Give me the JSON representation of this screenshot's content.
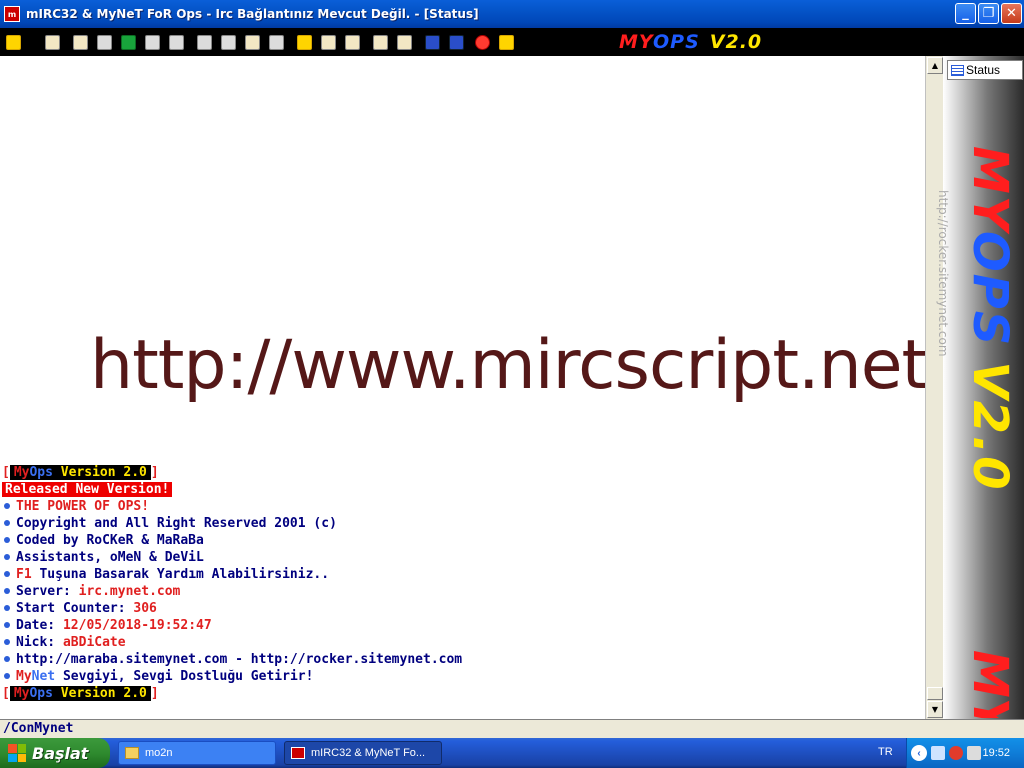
{
  "window": {
    "title": "mIRC32 & MyNeT FoR Ops - Irc Bağlantınız Mevcut Değil. - [Status]",
    "controls": {
      "minimize": "_",
      "restore": "❐",
      "close": "✕"
    }
  },
  "toolbar": {
    "icons": [
      "connect-icon",
      "options-icon",
      "channels-list-icon",
      "address-book-icon",
      "script-editor-icon",
      "dcc-icon",
      "notify-icon",
      "url-catcher-icon",
      "timer-icon",
      "colors-icon",
      "log-icon",
      "away-icon",
      "sounds-icon",
      "dcc-send-icon",
      "dcc-chat-icon",
      "notes-icon",
      "calendar-icon",
      "tile-icon",
      "cascade-icon",
      "help-icon",
      "lamp-icon"
    ],
    "brand": {
      "my": "MY",
      "ops": "OPS",
      "version": "V2.0"
    }
  },
  "status_window": {
    "watermark_url": "http://www.mircscript.net",
    "log": [
      {
        "type": "version",
        "open": "[",
        "my": "My",
        "ops": "Ops",
        "text": " Version 2.0",
        "close": "]"
      },
      {
        "type": "released",
        "text": "Released New Version!"
      },
      {
        "type": "line",
        "segments": [
          {
            "text": "THE POWER OF OPS!",
            "color": "red"
          }
        ]
      },
      {
        "type": "line",
        "segments": [
          {
            "text": "Copyright and All Right Reserved 2001 (c)",
            "color": "blue"
          }
        ]
      },
      {
        "type": "line",
        "segments": [
          {
            "text": "Coded by RoCKeR & MaRaBa",
            "color": "blue"
          }
        ]
      },
      {
        "type": "line",
        "segments": [
          {
            "text": "Assistants, oMeN & DeViL",
            "color": "blue"
          }
        ]
      },
      {
        "type": "line",
        "segments": [
          {
            "text": "F1",
            "color": "red"
          },
          {
            "text": " Tuşuna Basarak Yardım Alabilirsiniz..",
            "color": "blue"
          }
        ]
      },
      {
        "type": "line",
        "segments": [
          {
            "text": "Server: ",
            "color": "blue"
          },
          {
            "text": "irc.mynet.com",
            "color": "red"
          }
        ]
      },
      {
        "type": "line",
        "segments": [
          {
            "text": "Start Counter: ",
            "color": "blue"
          },
          {
            "text": "306",
            "color": "red"
          }
        ]
      },
      {
        "type": "line",
        "segments": [
          {
            "text": "Date: ",
            "color": "blue"
          },
          {
            "text": "12/05/2018-19:52:47",
            "color": "red"
          }
        ]
      },
      {
        "type": "line",
        "segments": [
          {
            "text": "Nick: ",
            "color": "blue"
          },
          {
            "text": "aBDiCate",
            "color": "red"
          }
        ]
      },
      {
        "type": "line",
        "segments": [
          {
            "text": "http://maraba.sitemynet.com - http://rocker.sitemynet.com",
            "color": "blue"
          }
        ]
      },
      {
        "type": "line",
        "segments": [
          {
            "text": "My",
            "color": "red"
          },
          {
            "text": "Net",
            "color": "ltblue"
          },
          {
            "text": " Sevgiyi, Sevgi Dostluğu Getirir!",
            "color": "blue"
          }
        ]
      },
      {
        "type": "version",
        "open": "[",
        "my": "My",
        "ops": "Ops",
        "text": " Version 2.0",
        "close": "]"
      }
    ]
  },
  "switchbar": {
    "item_label": "Status",
    "vertical_brand": {
      "my": "MY",
      "ops": "OPS",
      "version": "V2.0"
    },
    "vertical_url": "http://rocker.sitemynet.com",
    "bottom_brand": "MY"
  },
  "editbox": {
    "value": "/ConMynet"
  },
  "taskbar": {
    "start_label": "Başlat",
    "tasks": [
      {
        "label": "mo2n",
        "icon": "folder-icon"
      },
      {
        "label": "mIRC32 & MyNeT Fo...",
        "icon": "mirc-icon"
      }
    ],
    "language": "TR",
    "clock": "19:52"
  },
  "colors": {
    "red": "#e02020",
    "blue": "#00007f",
    "ltblue": "#3a6ff0",
    "watermark": "#551818",
    "brand_red": "#ff1e1e",
    "brand_blue": "#1e5bff",
    "brand_yellow": "#ffe600"
  }
}
